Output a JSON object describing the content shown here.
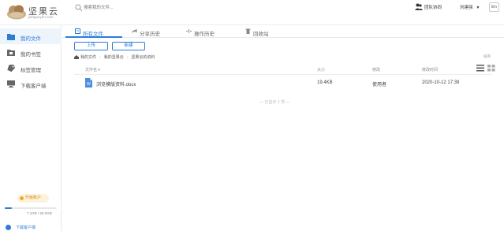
{
  "app": {
    "logo_title": "坚果云",
    "logo_subtitle": "jianguoyun.com",
    "search_placeholder": "搜索我的文件...",
    "team_link": "团队协同",
    "user_name": "刘建强",
    "lang": "En"
  },
  "sidebar": {
    "items": [
      {
        "label": "我的文件",
        "icon": "folder-icon",
        "active": true
      },
      {
        "label": "我的书签",
        "icon": "bookmark-icon",
        "active": false
      },
      {
        "label": "标签管理",
        "icon": "tag-icon",
        "active": false
      },
      {
        "label": "下载客户端",
        "icon": "monitor-icon",
        "active": false
      }
    ],
    "upgrade_label": "升级账户",
    "usage_text": "7.1GB / 50.0GB",
    "usage_fraction": 0.14,
    "client_link": "下载客户端"
  },
  "tabs": [
    {
      "label": "所有文件",
      "icon": "files-icon",
      "active": true
    },
    {
      "label": "分享历史",
      "icon": "share-icon",
      "active": false
    },
    {
      "label": "操作历史",
      "icon": "history-icon",
      "active": false
    },
    {
      "label": "回收站",
      "icon": "trash-icon",
      "active": false
    }
  ],
  "toolbar": {
    "upload_label": "上传",
    "new_label": "新建"
  },
  "breadcrumb": {
    "items": [
      "我的文件",
      "我的坚果云",
      "坚果云的资料"
    ],
    "sort_label": "排序"
  },
  "table": {
    "columns": {
      "name": "文件名",
      "size": "大小",
      "modifier": "修改",
      "modified": "修改时间"
    },
    "rows": [
      {
        "name": "浏览模版资料.docx",
        "size": "19.4KB",
        "modifier": "使用者",
        "modified": "2020-10-12 17:39",
        "icon": "word-doc-icon"
      }
    ],
    "end_text": "— 已显示 1 项 —"
  },
  "colors": {
    "accent": "#2f7cd6",
    "upgrade": "#f2a82a"
  }
}
